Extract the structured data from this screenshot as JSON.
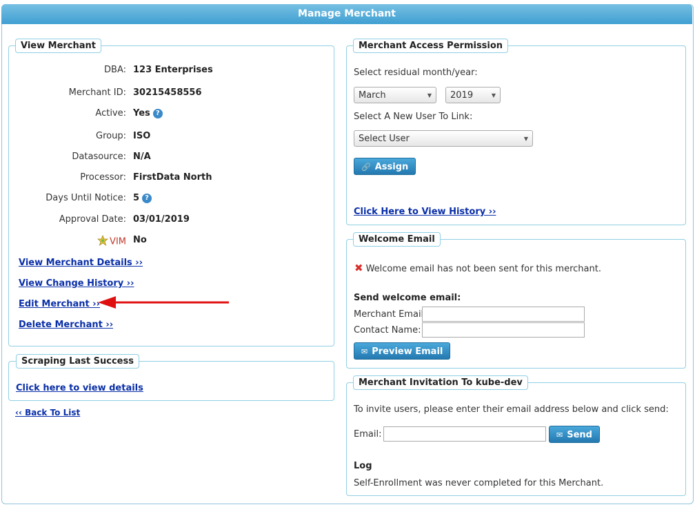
{
  "title": "Manage Merchant",
  "view_merchant": {
    "legend": "View Merchant",
    "fields": [
      {
        "label": "DBA:",
        "value": "123 Enterprises"
      },
      {
        "label": "Merchant ID:",
        "value": "30215458556"
      },
      {
        "label": "Active:",
        "value": "Yes"
      },
      {
        "label": "Group:",
        "value": "ISO"
      },
      {
        "label": "Datasource:",
        "value": "N/A"
      },
      {
        "label": "Processor:",
        "value": "FirstData North"
      },
      {
        "label": "Days Until Notice:",
        "value": "5"
      },
      {
        "label": "Approval Date:",
        "value": "03/01/2019"
      },
      {
        "label": "VIM",
        "value": "No"
      }
    ],
    "links": [
      "View Merchant Details ››",
      "View Change History ››",
      "Edit Merchant ››",
      "Delete Merchant ››"
    ]
  },
  "scraping": {
    "legend": "Scraping Last Success",
    "link": "Click here to view details"
  },
  "back_link": "‹‹ Back To List",
  "access": {
    "legend": "Merchant Access Permission",
    "residual_label": "Select residual month/year:",
    "month": "March",
    "year": "2019",
    "user_label": "Select A New User To Link:",
    "user_select": "Select User",
    "assign_button": "Assign",
    "history_link": "Click Here to View History ››"
  },
  "welcome": {
    "legend": "Welcome Email",
    "status": "Welcome email has not been sent for this merchant.",
    "send_heading": "Send welcome email:",
    "email_label": "Merchant Email:",
    "contact_label": "Contact Name:",
    "preview_button": "Preview Email"
  },
  "invitation": {
    "legend": "Merchant Invitation To kube-dev",
    "instructions": "To invite users, please enter their email address below and click send:",
    "email_label": "Email:",
    "send_button": "Send",
    "log_heading": "Log",
    "log_text": "Self-Enrollment was never completed for this Merchant."
  },
  "colors": {
    "header": "#3f9fd1",
    "link": "#0a2fa8",
    "arrow": "#e01010",
    "error": "#d9302c"
  }
}
